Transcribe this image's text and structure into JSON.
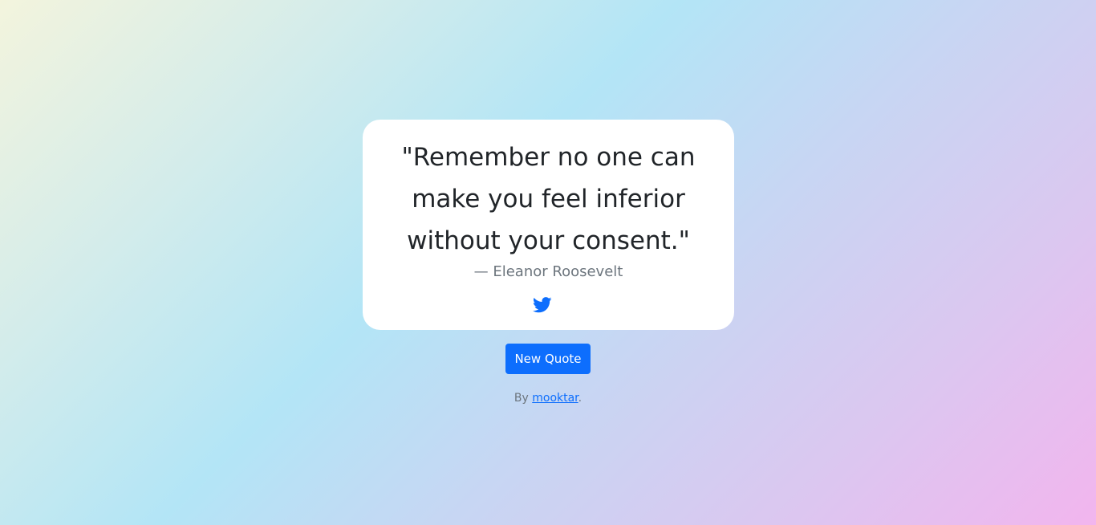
{
  "quote": {
    "text": "\"Remember no one can make you feel inferior without your consent.\"",
    "author": "— Eleanor Roosevelt",
    "tweet_icon": "twitter-bird-icon"
  },
  "actions": {
    "new_quote_label": "New Quote"
  },
  "footer": {
    "by_prefix": "By ",
    "author_link": "mooktar",
    "suffix": "."
  },
  "colors": {
    "accent": "#0d6efd",
    "text": "#212529",
    "muted": "#6c757d",
    "card": "#ffffff"
  }
}
